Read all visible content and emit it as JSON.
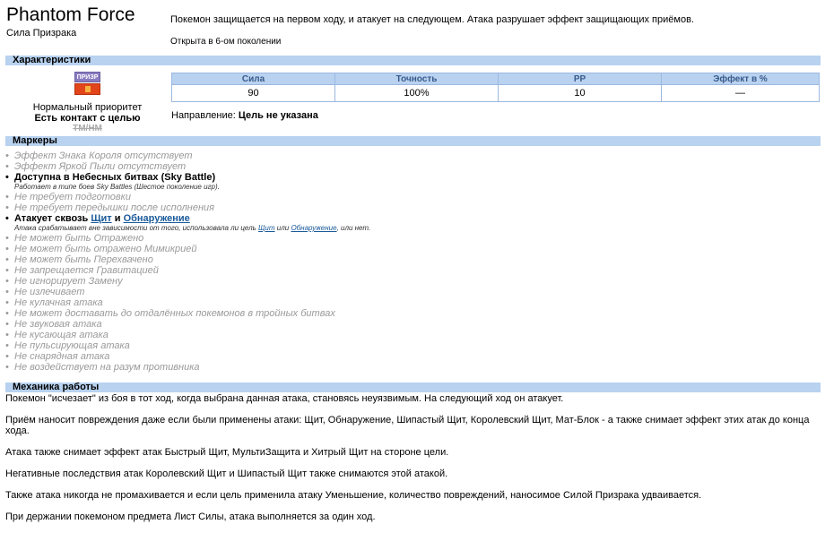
{
  "move": {
    "name": "Phantom Force",
    "name_ru": "Сила Призрака",
    "description": "Покемон защищается на первом ходу, и атакует на следующем. Атака разрушает эффект защищающих приёмов.",
    "generation": "Открыта в 6-ом поколении"
  },
  "sections": {
    "characteristics": "Характеристики",
    "markers": "Маркеры",
    "mechanics": "Механика работы"
  },
  "badges": {
    "category_label": "ПРИЗР",
    "category_color": "#8a7cc0",
    "type_color": "#e2451a"
  },
  "left_info": {
    "priority": "Нормальный приоритет",
    "contact": "Есть контакт с целью",
    "tm": "TM/HM"
  },
  "stats": {
    "headers": [
      "Сила",
      "Точность",
      "PP",
      "Эффект в %"
    ],
    "values": [
      "90",
      "100%",
      "10",
      "—"
    ]
  },
  "direction": {
    "label": "Направление:",
    "value": "Цель не указана"
  },
  "markers": {
    "m1": "Эффект Знака Короля отсутствует",
    "m2": "Эффект Яркой Пыли отсутствует",
    "m3": "Доступна в Небесных битвах (Sky Battle)",
    "m3_note": "Работает в типе боев Sky Battles (Шестое поколение игр).",
    "m4": "Не требует подготовки",
    "m5": "Не требует передышки после исполнения",
    "m6_prefix": "Атакует сквозь",
    "m6_link1": "Щит",
    "m6_and": "и",
    "m6_link2": "Обнаружение",
    "m6_note_prefix": "Атака срабатывает вне зависимости от того, использовала ли цель",
    "m6_note_link1": "Щит",
    "m6_note_or": "или",
    "m6_note_link2": "Обнаружение",
    "m6_note_suffix": ", или нет.",
    "list": [
      "Не может быть Отражено",
      "Не может быть отражено Мимикрией",
      "Не может быть Перехвачено",
      "Не запрещается Гравитацией",
      "Не игнорирует Замену",
      "Не излечивает",
      "Не кулачная атака",
      "Не может доставать до отдалённых покемонов в тройных битвах",
      "Не звуковая атака",
      "Не кусающая атака",
      "Не пульсирующая атака",
      "Не снарядная атака",
      "Не воздействует на разум противника"
    ]
  },
  "mechanics": {
    "p1": "Покемон \"исчезает\" из боя в тот ход, когда выбрана данная атака, становясь неуязвимым. На следующий ход он атакует.",
    "p2": "Приём наносит повреждения даже если были применены атаки: Щит, Обнаружение, Шипастый Щит, Королевский Щит, Мат-Блок - а также снимает эффект этих атак до конца хода.",
    "p3": "Атака также снимает эффект атак Быстрый Щит, МультиЗащита и Хитрый Щит на стороне цели.",
    "p4": "Негативные последствия атак Королевский Щит и Шипастый Щит также снимаются этой атакой.",
    "p5": "Также атака никогда не промахивается и если цель применила атаку Уменьшение, количество повреждений, наносимое Силой Призрака удваивается.",
    "p6": "При держании покемоном предмета Лист Силы, атака выполняется за один ход."
  }
}
